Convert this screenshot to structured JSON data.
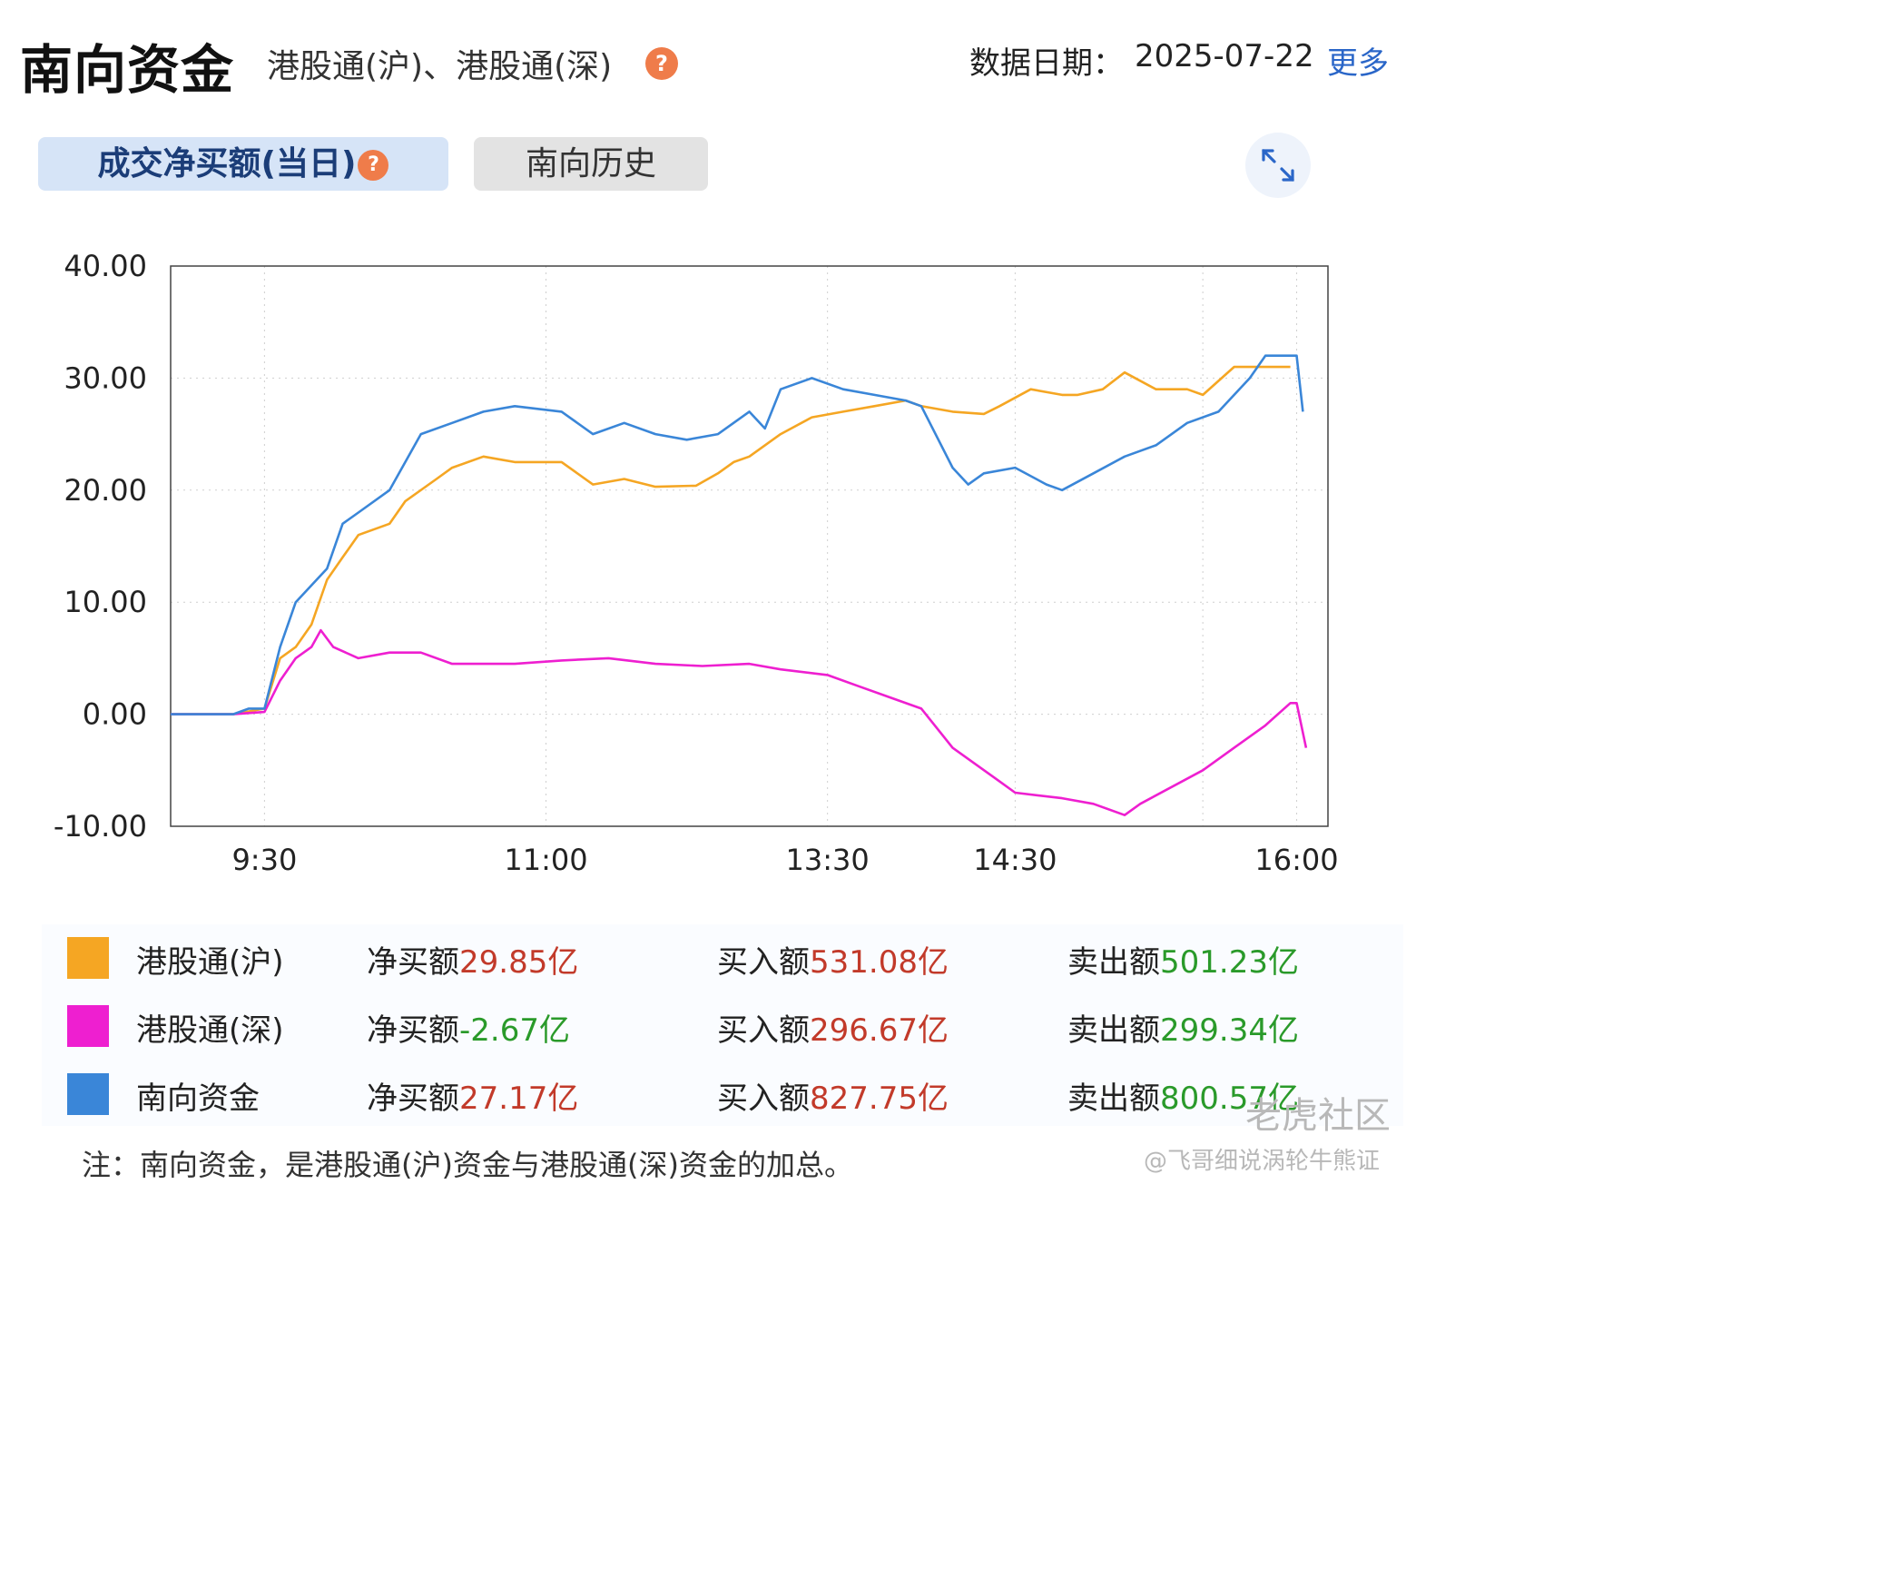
{
  "header": {
    "title": "南向资金",
    "subtitle": "港股通(沪)、港股通(深)",
    "date_label": "数据日期：",
    "date_value": "2025-07-22",
    "more": "更多",
    "help_glyph": "?"
  },
  "tabs": [
    {
      "label": "成交净买额(当日)",
      "active": true
    },
    {
      "label": "南向历史",
      "active": false
    }
  ],
  "colors": {
    "sh": "#f5a623",
    "sz": "#ee1fd0",
    "total": "#3a86d8",
    "accent": "#2a66c8",
    "positive": "#c23a2a",
    "negative": "#2a9a2a"
  },
  "chart_data": {
    "type": "line",
    "ylim": [
      -10,
      40
    ],
    "yticks": [
      "40.00",
      "30.00",
      "20.00",
      "10.00",
      "0.00",
      "-10.00"
    ],
    "xticks": [
      "9:30",
      "11:00",
      "13:30",
      "14:30",
      "16:00"
    ],
    "xtick_minutes": [
      0,
      90,
      180,
      240,
      330
    ],
    "xlim": [
      -30,
      340
    ],
    "grid": true,
    "series": [
      {
        "name": "港股通(沪)",
        "color": "#f5a623",
        "points": [
          [
            -30,
            0
          ],
          [
            -10,
            0
          ],
          [
            0,
            0.5
          ],
          [
            5,
            5
          ],
          [
            10,
            6
          ],
          [
            15,
            8
          ],
          [
            20,
            12
          ],
          [
            25,
            14
          ],
          [
            30,
            16
          ],
          [
            40,
            17
          ],
          [
            45,
            19
          ],
          [
            55,
            21
          ],
          [
            60,
            22
          ],
          [
            70,
            23
          ],
          [
            80,
            22.5
          ],
          [
            95,
            22.5
          ],
          [
            105,
            20.5
          ],
          [
            115,
            21
          ],
          [
            125,
            20.3
          ],
          [
            138,
            20.4
          ],
          [
            145,
            21.5
          ],
          [
            150,
            22.5
          ],
          [
            155,
            23
          ],
          [
            165,
            25
          ],
          [
            175,
            26.5
          ],
          [
            185,
            27
          ],
          [
            195,
            27.5
          ],
          [
            205,
            28
          ],
          [
            210,
            27.5
          ],
          [
            220,
            27
          ],
          [
            230,
            26.8
          ],
          [
            235,
            27.5
          ],
          [
            245,
            29
          ],
          [
            255,
            28.5
          ],
          [
            260,
            28.5
          ],
          [
            268,
            29
          ],
          [
            275,
            30.5
          ],
          [
            285,
            29
          ],
          [
            295,
            29
          ],
          [
            300,
            28.5
          ],
          [
            310,
            31
          ],
          [
            320,
            31
          ],
          [
            328,
            31
          ]
        ]
      },
      {
        "name": "港股通(深)",
        "color": "#ee1fd0",
        "points": [
          [
            -30,
            0
          ],
          [
            -10,
            0
          ],
          [
            0,
            0.2
          ],
          [
            5,
            3
          ],
          [
            10,
            5
          ],
          [
            15,
            6
          ],
          [
            18,
            7.5
          ],
          [
            22,
            6
          ],
          [
            30,
            5
          ],
          [
            40,
            5.5
          ],
          [
            50,
            5.5
          ],
          [
            60,
            4.5
          ],
          [
            70,
            4.5
          ],
          [
            80,
            4.5
          ],
          [
            95,
            4.8
          ],
          [
            110,
            5
          ],
          [
            125,
            4.5
          ],
          [
            140,
            4.3
          ],
          [
            155,
            4.5
          ],
          [
            165,
            4
          ],
          [
            180,
            3.5
          ],
          [
            190,
            2.5
          ],
          [
            200,
            1.5
          ],
          [
            210,
            0.5
          ],
          [
            220,
            -3
          ],
          [
            235,
            -6
          ],
          [
            240,
            -7
          ],
          [
            255,
            -7.5
          ],
          [
            265,
            -8
          ],
          [
            275,
            -9
          ],
          [
            280,
            -8
          ],
          [
            300,
            -5
          ],
          [
            310,
            -3
          ],
          [
            320,
            -1
          ],
          [
            328,
            1
          ],
          [
            330,
            1
          ],
          [
            333,
            -3
          ]
        ]
      },
      {
        "name": "南向资金",
        "color": "#3a86d8",
        "points": [
          [
            -30,
            0
          ],
          [
            -10,
            0
          ],
          [
            -5,
            0.5
          ],
          [
            0,
            0.5
          ],
          [
            5,
            6
          ],
          [
            10,
            10
          ],
          [
            20,
            13
          ],
          [
            25,
            17
          ],
          [
            30,
            18
          ],
          [
            40,
            20
          ],
          [
            50,
            25
          ],
          [
            60,
            26
          ],
          [
            70,
            27
          ],
          [
            80,
            27.5
          ],
          [
            95,
            27
          ],
          [
            105,
            25
          ],
          [
            115,
            26
          ],
          [
            125,
            25
          ],
          [
            135,
            24.5
          ],
          [
            145,
            25
          ],
          [
            155,
            27
          ],
          [
            160,
            25.5
          ],
          [
            165,
            29
          ],
          [
            175,
            30
          ],
          [
            185,
            29
          ],
          [
            195,
            28.5
          ],
          [
            205,
            28
          ],
          [
            210,
            27.5
          ],
          [
            220,
            22
          ],
          [
            225,
            20.5
          ],
          [
            230,
            21.5
          ],
          [
            240,
            22
          ],
          [
            250,
            20.5
          ],
          [
            255,
            20
          ],
          [
            265,
            21.5
          ],
          [
            275,
            23
          ],
          [
            285,
            24
          ],
          [
            295,
            26
          ],
          [
            305,
            27
          ],
          [
            315,
            30
          ],
          [
            320,
            32
          ],
          [
            328,
            32
          ],
          [
            330,
            32
          ],
          [
            332,
            27
          ]
        ]
      }
    ]
  },
  "legend": [
    {
      "name": "港股通(沪)",
      "net_label": "净买额",
      "net_value": "29.85亿",
      "buy_label": "买入额",
      "buy_value": "531.08亿",
      "sell_label": "卖出额",
      "sell_value": "501.23亿"
    },
    {
      "name": "港股通(深)",
      "net_label": "净买额",
      "net_value": "-2.67亿",
      "buy_label": "买入额",
      "buy_value": "296.67亿",
      "sell_label": "卖出额",
      "sell_value": "299.34亿"
    },
    {
      "name": "南向资金",
      "net_label": "净买额",
      "net_value": "27.17亿",
      "buy_label": "买入额",
      "buy_value": "827.75亿",
      "sell_label": "卖出额",
      "sell_value": "800.57亿"
    }
  ],
  "note": "注：南向资金，是港股通(沪)资金与港股通(深)资金的加总。",
  "watermark": "老虎社区",
  "watermark_user": "@飞哥细说涡轮牛熊证"
}
